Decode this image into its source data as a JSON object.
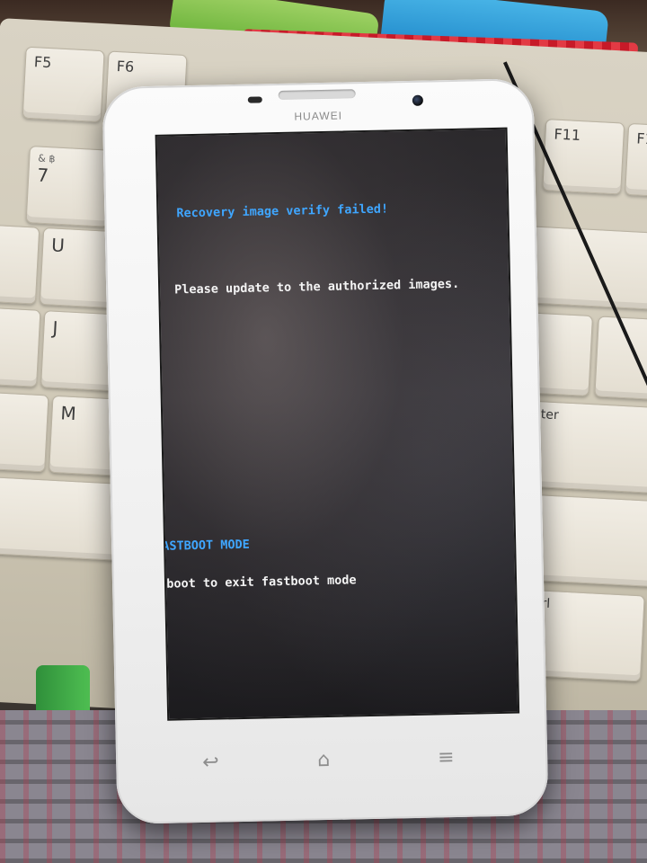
{
  "device": {
    "brand": "HUAWEI"
  },
  "screen": {
    "error_title": "Recovery image verify failed!",
    "error_message": "Please update to the authorized images.",
    "mode_title": "FASTBOOT MODE",
    "mode_hint": "Reboot to exit fastboot mode"
  },
  "keyboard": {
    "keys": [
      "F5",
      "F6",
      "F11",
      "F12",
      "7",
      "8",
      "U",
      "J",
      "M",
      "Enter",
      "Ctrl"
    ]
  },
  "colors": {
    "accent_text": "#3fa6ff",
    "body_text": "#f4f4f4",
    "phone_body": "#f5f5f5"
  },
  "icons": {
    "nav": [
      "back-icon",
      "home-icon",
      "menu-icon"
    ]
  }
}
